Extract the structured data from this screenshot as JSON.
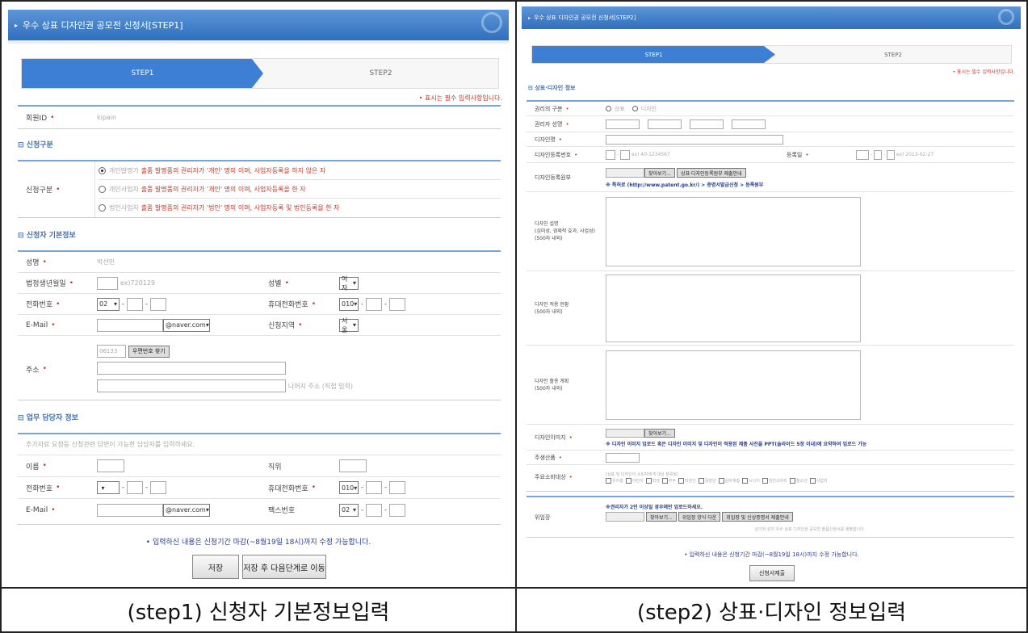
{
  "captions": {
    "left": "(step1) 신청자 기본정보입력",
    "right": "(step2) 상표·디자인 정보입력"
  },
  "s1": {
    "title": "우수 상표 디자인권 공모전 신청서[STEP1]",
    "steps": [
      "STEP1",
      "STEP2"
    ],
    "required_note": "• 표시는 필수 입력사항입니다.",
    "member_id_label": "회원ID",
    "member_id_value": "kipain",
    "sec_type": "신청구분",
    "type_label": "신청구분",
    "type_options": [
      {
        "pre": "개인발명가",
        "hl": "출품 발명품의 권리자가 '개인' 명의 이며, 사업자등록을 하지 않은 자"
      },
      {
        "pre": "개인사업자",
        "hl": "출품 발명품의 권리자가 '개인' 명의 이며, 사업자등록을 한 자"
      },
      {
        "pre": "법인사업자",
        "hl": "출품 발명품의 권리자가 '법인' 명의 이며, 사업자등록 및 법인등록을 한 자"
      }
    ],
    "sec_basic": "신청자 기본정보",
    "name_label": "성명",
    "name_value": "박선민",
    "birth_label": "법정생년월일",
    "birth_hint": "ex)720129",
    "gender_label": "성별",
    "gender_value": "여자",
    "phone_label": "전화번호",
    "phone_area": "02",
    "mobile_label": "휴대전화번호",
    "mobile_prefix": "010",
    "email_label": "E-Mail",
    "email_domain": "@naver.com",
    "region_label": "신청지역",
    "region_value": "서울",
    "addr_label": "주소",
    "zip_value": "06133",
    "zip_btn": "우편번호 찾기",
    "addr_hint": "나머지 주소 (직접 입력)",
    "sec_staff": "업무 담당자 정보",
    "staff_note": "추가자료 요청등 신청관련 답변이 가능한 담당자를 입력하세요.",
    "staff_name_label": "이름",
    "staff_pos_label": "직위",
    "staff_phone_label": "전화번호",
    "staff_mobile_label": "휴대전화번호",
    "staff_mobile_prefix": "010",
    "staff_email_label": "E-Mail",
    "staff_email_domain": "@naver.com",
    "fax_label": "팩스번호",
    "fax_area": "02",
    "deadline": "• 입력하신 내용은 신청기간 마감(~8월19일 18시)까지 수정 가능합니다.",
    "save_btn": "저장",
    "save_next_btn": "저장 후 다음단계로 이동"
  },
  "s2": {
    "title": "우수 상표 디자인권 공모전 신청서[STEP2]",
    "steps": [
      "STEP1",
      "STEP2"
    ],
    "required_note": "• 표시는 필수 입력사항입니다.",
    "sec_info": "상표·디자인 정보",
    "right_type_label": "권리의 구분",
    "right_type_opts": [
      "상표",
      "디자인"
    ],
    "right_name_label": "권리자 성명",
    "design_name_label": "디자인명",
    "reg_no_label": "디자인등록번호",
    "reg_no_hint": "ex) 40-1234567",
    "reg_date_label": "등록일",
    "reg_date_hint": "ex) 2013-02-27",
    "reg_file_label": "디자인등록원부",
    "browse": "찾아보기...",
    "reg_file_btn": "상표·디자인등록원부 제출안내",
    "reg_note": "※ 특허로 (http://www.patent.go.kr/) > 증명서발급신청 > 등록원부",
    "desc_label": "디자인 설명\n(심미성, 경제적 효과, 사업성)\n(500자 내외)",
    "status_label": "디자인 적용 현황\n(500자 내외)",
    "plan_label": "디자인 활용 계획\n(500자 내외)",
    "image_label": "디자인이미지",
    "image_note": "※ 디자인 이미지 업로드 혹은 디자인 이미지 및 디자인이 적용된 제품 사진을 PPT(슬라이드 5장 이내)에 요약하여 업로드 가능",
    "main_item_label": "주생산품",
    "consumer_label": "주요소비대상",
    "consumer_note": "[상표 및 디자인이 소비자에게 대상 분류로]",
    "consumer_opts": [
      "유아층",
      "어린이",
      "학생",
      "주부",
      "직장인",
      "중장년",
      "실버계층",
      "시니어",
      "일반소비자",
      "청소년",
      "사업자"
    ],
    "consent_label": "위임장",
    "consent_note": "※권리자가 2인 이상일 경우에만 업로드하세요.",
    "consent_btn1": "위임장 양식 다운",
    "consent_btn2": "위임장 및 신상증명서 제출안내",
    "consent_sub": "상기와 같이 우수 상표 디자인권 공모전 출품신청서를 제출합니다.",
    "deadline": "• 입력하신 내용은 신청기간 마감(~8월19일 18시)까지 수정 가능합니다.",
    "submit_btn": "신청서제출"
  }
}
